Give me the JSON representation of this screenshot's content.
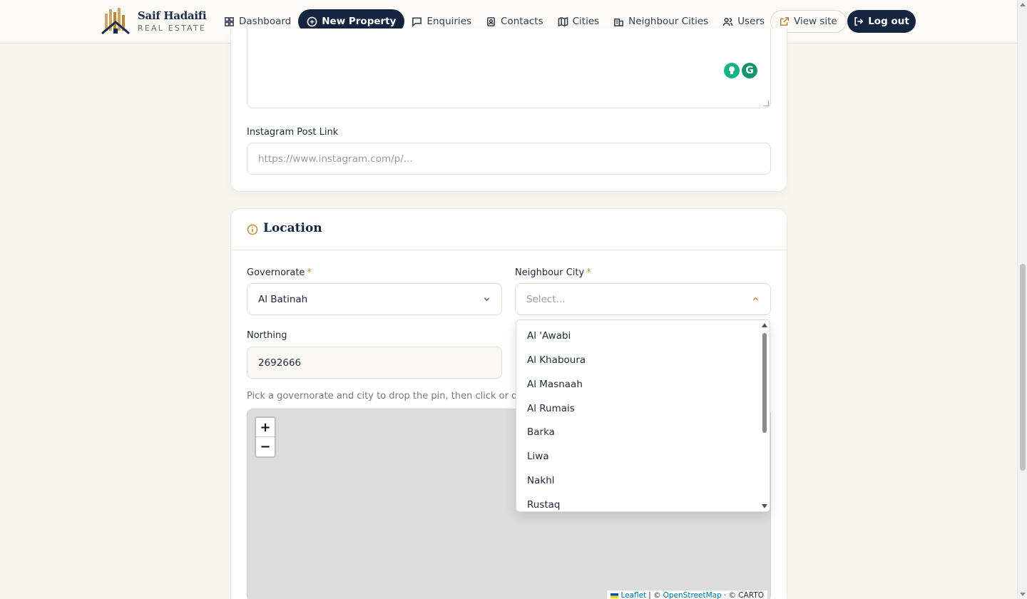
{
  "brand": {
    "name": "Saif Hadaifi",
    "subtitle": "REAL ESTATE"
  },
  "nav": {
    "items": [
      {
        "label": "Dashboard",
        "icon": "grid-icon"
      },
      {
        "label": "New Property",
        "icon": "plus-circle-icon",
        "active": true
      },
      {
        "label": "Enquiries",
        "icon": "message-icon"
      },
      {
        "label": "Contacts",
        "icon": "contact-icon"
      },
      {
        "label": "Cities",
        "icon": "map-icon"
      },
      {
        "label": "Neighbour Cities",
        "icon": "building-icon"
      },
      {
        "label": "Users",
        "icon": "users-icon"
      }
    ],
    "view_site": "View site",
    "logout": "Log out"
  },
  "form": {
    "instagram_label": "Instagram Post Link",
    "instagram_placeholder": "https://www.instagram.com/p/..."
  },
  "location": {
    "title": "Location",
    "governorate_label": "Governorate",
    "governorate_value": "Al Batinah",
    "neighbour_city_label": "Neighbour City",
    "neighbour_city_placeholder": "Select...",
    "northing_label": "Northing",
    "northing_value": "2692666",
    "hint": "Pick a governorate and city to drop the pin, then click or drag o",
    "neighbour_city_options": [
      "Al 'Awabi",
      "Al Khaboura",
      "Al Masnaah",
      "Al Rumais",
      "Barka",
      "Liwa",
      "Nakhl",
      "Rustaq"
    ]
  },
  "map": {
    "zoom_in": "+",
    "zoom_out": "−",
    "attribution_leaflet": "Leaflet",
    "attribution_sep": "| ©",
    "attribution_osm": "OpenStreetMap",
    "attribution_carto": "· © CARTO"
  },
  "colors": {
    "navy": "#15243f",
    "gold": "#c3872b",
    "background": "#f7f5ef"
  }
}
